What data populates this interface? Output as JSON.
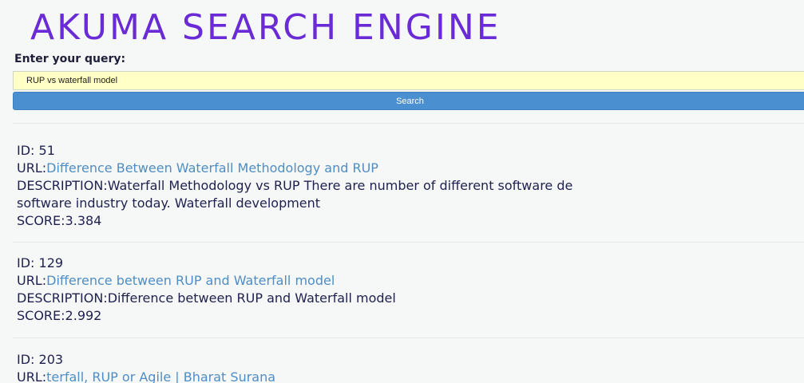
{
  "header": {
    "title": "AKUMA SEARCH ENGINE"
  },
  "search": {
    "label": "Enter your query:",
    "value": "RUP vs waterfall model",
    "button_label": "Search"
  },
  "results": [
    {
      "id_prefix": "ID: ",
      "id": "51",
      "url_prefix": "URL:",
      "url_text": "Difference Between Waterfall Methodology and RUP",
      "desc_prefix": "DESCRIPTION:",
      "desc_line1": "Waterfall Methodology vs RUP There are number of different software de",
      "desc_line2": "software industry today. Waterfall development",
      "score_prefix": "SCORE:",
      "score": "3.384"
    },
    {
      "id_prefix": "ID: ",
      "id": "129",
      "url_prefix": "URL:",
      "url_text": "Difference between RUP and Waterfall model",
      "desc_prefix": "DESCRIPTION:",
      "desc_line1": "Difference between RUP and Waterfall model",
      "score_prefix": "SCORE:",
      "score": "2.992"
    },
    {
      "id_prefix": "ID: ",
      "id": "203",
      "url_prefix": "URL:",
      "url_text": "terfall, RUP or Agile | Bharat Surana"
    }
  ],
  "colors": {
    "title": "#6a2bd6",
    "link": "#4f8dc4",
    "button": "#4a8fcf",
    "input_background": "#ffffc6"
  }
}
